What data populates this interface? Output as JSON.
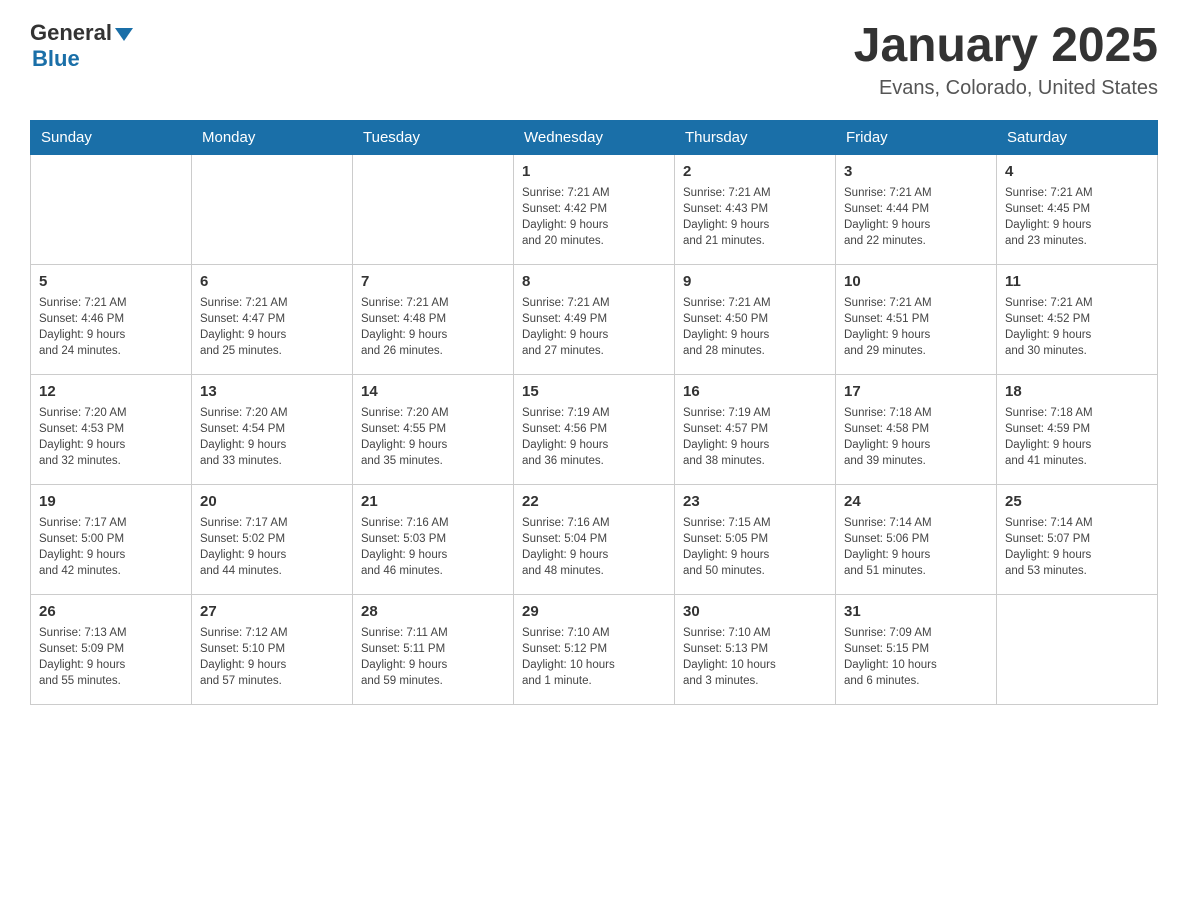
{
  "logo": {
    "general": "General",
    "blue": "Blue"
  },
  "title": "January 2025",
  "location": "Evans, Colorado, United States",
  "days_of_week": [
    "Sunday",
    "Monday",
    "Tuesday",
    "Wednesday",
    "Thursday",
    "Friday",
    "Saturday"
  ],
  "weeks": [
    [
      {
        "day": "",
        "info": ""
      },
      {
        "day": "",
        "info": ""
      },
      {
        "day": "",
        "info": ""
      },
      {
        "day": "1",
        "info": "Sunrise: 7:21 AM\nSunset: 4:42 PM\nDaylight: 9 hours\nand 20 minutes."
      },
      {
        "day": "2",
        "info": "Sunrise: 7:21 AM\nSunset: 4:43 PM\nDaylight: 9 hours\nand 21 minutes."
      },
      {
        "day": "3",
        "info": "Sunrise: 7:21 AM\nSunset: 4:44 PM\nDaylight: 9 hours\nand 22 minutes."
      },
      {
        "day": "4",
        "info": "Sunrise: 7:21 AM\nSunset: 4:45 PM\nDaylight: 9 hours\nand 23 minutes."
      }
    ],
    [
      {
        "day": "5",
        "info": "Sunrise: 7:21 AM\nSunset: 4:46 PM\nDaylight: 9 hours\nand 24 minutes."
      },
      {
        "day": "6",
        "info": "Sunrise: 7:21 AM\nSunset: 4:47 PM\nDaylight: 9 hours\nand 25 minutes."
      },
      {
        "day": "7",
        "info": "Sunrise: 7:21 AM\nSunset: 4:48 PM\nDaylight: 9 hours\nand 26 minutes."
      },
      {
        "day": "8",
        "info": "Sunrise: 7:21 AM\nSunset: 4:49 PM\nDaylight: 9 hours\nand 27 minutes."
      },
      {
        "day": "9",
        "info": "Sunrise: 7:21 AM\nSunset: 4:50 PM\nDaylight: 9 hours\nand 28 minutes."
      },
      {
        "day": "10",
        "info": "Sunrise: 7:21 AM\nSunset: 4:51 PM\nDaylight: 9 hours\nand 29 minutes."
      },
      {
        "day": "11",
        "info": "Sunrise: 7:21 AM\nSunset: 4:52 PM\nDaylight: 9 hours\nand 30 minutes."
      }
    ],
    [
      {
        "day": "12",
        "info": "Sunrise: 7:20 AM\nSunset: 4:53 PM\nDaylight: 9 hours\nand 32 minutes."
      },
      {
        "day": "13",
        "info": "Sunrise: 7:20 AM\nSunset: 4:54 PM\nDaylight: 9 hours\nand 33 minutes."
      },
      {
        "day": "14",
        "info": "Sunrise: 7:20 AM\nSunset: 4:55 PM\nDaylight: 9 hours\nand 35 minutes."
      },
      {
        "day": "15",
        "info": "Sunrise: 7:19 AM\nSunset: 4:56 PM\nDaylight: 9 hours\nand 36 minutes."
      },
      {
        "day": "16",
        "info": "Sunrise: 7:19 AM\nSunset: 4:57 PM\nDaylight: 9 hours\nand 38 minutes."
      },
      {
        "day": "17",
        "info": "Sunrise: 7:18 AM\nSunset: 4:58 PM\nDaylight: 9 hours\nand 39 minutes."
      },
      {
        "day": "18",
        "info": "Sunrise: 7:18 AM\nSunset: 4:59 PM\nDaylight: 9 hours\nand 41 minutes."
      }
    ],
    [
      {
        "day": "19",
        "info": "Sunrise: 7:17 AM\nSunset: 5:00 PM\nDaylight: 9 hours\nand 42 minutes."
      },
      {
        "day": "20",
        "info": "Sunrise: 7:17 AM\nSunset: 5:02 PM\nDaylight: 9 hours\nand 44 minutes."
      },
      {
        "day": "21",
        "info": "Sunrise: 7:16 AM\nSunset: 5:03 PM\nDaylight: 9 hours\nand 46 minutes."
      },
      {
        "day": "22",
        "info": "Sunrise: 7:16 AM\nSunset: 5:04 PM\nDaylight: 9 hours\nand 48 minutes."
      },
      {
        "day": "23",
        "info": "Sunrise: 7:15 AM\nSunset: 5:05 PM\nDaylight: 9 hours\nand 50 minutes."
      },
      {
        "day": "24",
        "info": "Sunrise: 7:14 AM\nSunset: 5:06 PM\nDaylight: 9 hours\nand 51 minutes."
      },
      {
        "day": "25",
        "info": "Sunrise: 7:14 AM\nSunset: 5:07 PM\nDaylight: 9 hours\nand 53 minutes."
      }
    ],
    [
      {
        "day": "26",
        "info": "Sunrise: 7:13 AM\nSunset: 5:09 PM\nDaylight: 9 hours\nand 55 minutes."
      },
      {
        "day": "27",
        "info": "Sunrise: 7:12 AM\nSunset: 5:10 PM\nDaylight: 9 hours\nand 57 minutes."
      },
      {
        "day": "28",
        "info": "Sunrise: 7:11 AM\nSunset: 5:11 PM\nDaylight: 9 hours\nand 59 minutes."
      },
      {
        "day": "29",
        "info": "Sunrise: 7:10 AM\nSunset: 5:12 PM\nDaylight: 10 hours\nand 1 minute."
      },
      {
        "day": "30",
        "info": "Sunrise: 7:10 AM\nSunset: 5:13 PM\nDaylight: 10 hours\nand 3 minutes."
      },
      {
        "day": "31",
        "info": "Sunrise: 7:09 AM\nSunset: 5:15 PM\nDaylight: 10 hours\nand 6 minutes."
      },
      {
        "day": "",
        "info": ""
      }
    ]
  ]
}
